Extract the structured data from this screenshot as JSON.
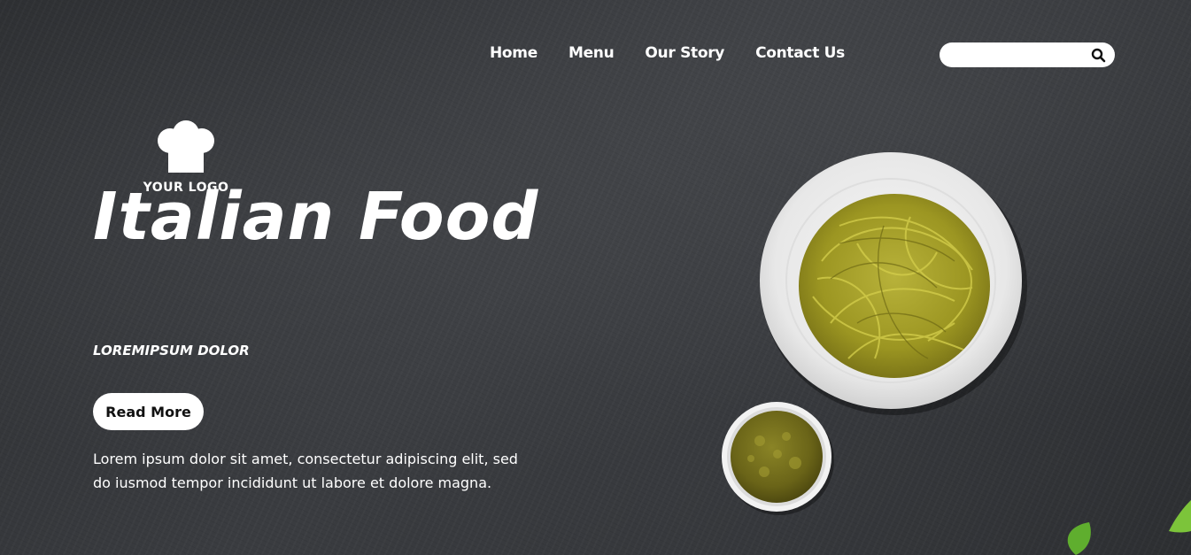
{
  "nav": {
    "items": [
      "Home",
      "Menu",
      "Our Story",
      "Contact Us"
    ]
  },
  "search": {
    "placeholder": "",
    "icon": "search-icon"
  },
  "logo": {
    "text": "YOUR LOGO",
    "icon": "chef-hat-icon"
  },
  "hero": {
    "title": "Italian Food",
    "subtitle": "LOREMIPSUM DOLOR",
    "button_label": "Read More",
    "body": "Lorem ipsum dolor sit amet, consectetur adipiscing elit, sed do iusmod tempor incididunt ut labore et dolore magna."
  },
  "colors": {
    "background": "#323437",
    "text": "#ffffff",
    "button_bg": "#ffffff",
    "pasta": "#a8a22a",
    "pesto": "#6e6a1c",
    "basil": "#5fae2e"
  }
}
